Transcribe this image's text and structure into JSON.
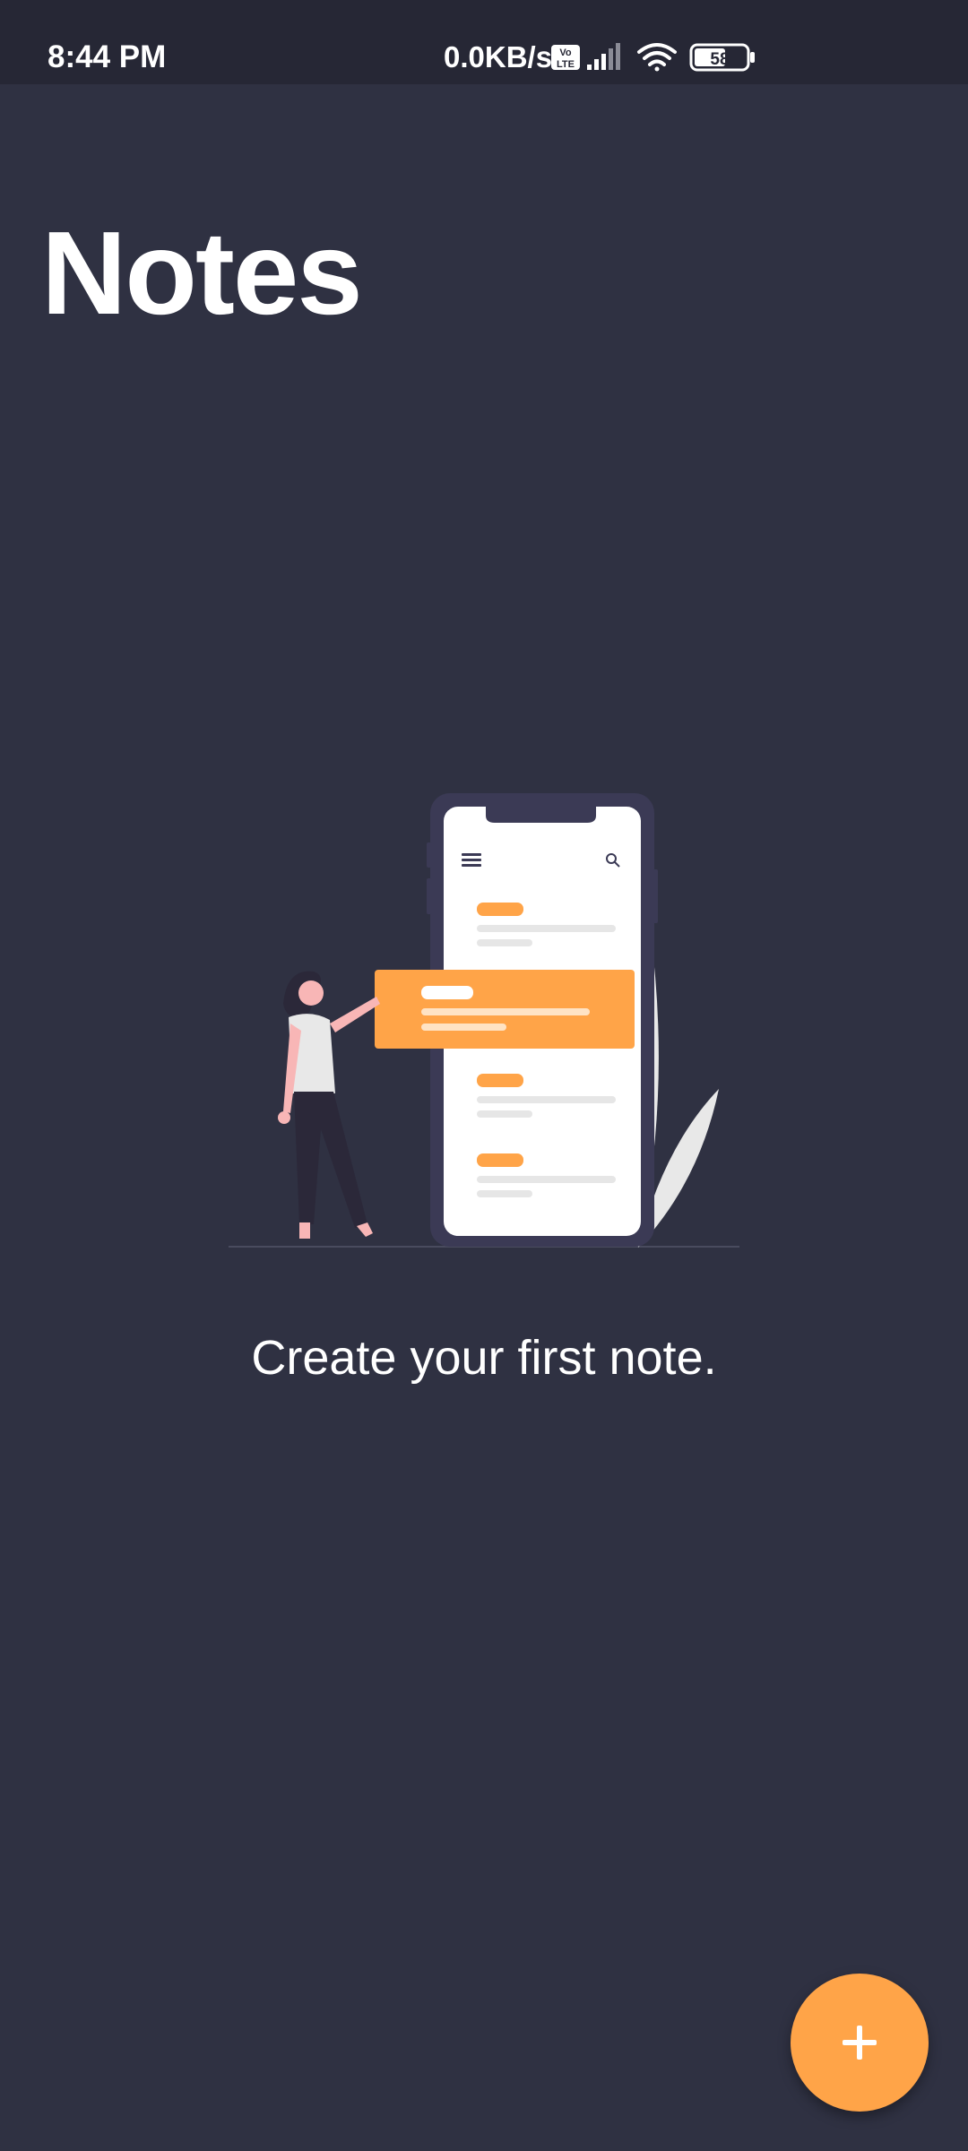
{
  "status_bar": {
    "time": "8:44 PM",
    "network_speed": "0.0KB/s",
    "volte_label": "Vo LTE",
    "battery_level": "58",
    "icons": [
      "volte-icon",
      "signal-icon",
      "wifi-icon",
      "battery-icon"
    ]
  },
  "header": {
    "title": "Notes"
  },
  "empty_state": {
    "message": "Create your first note.",
    "illustration": "person-holding-note-card-phone"
  },
  "fab": {
    "icon": "plus-icon",
    "label": "+"
  },
  "colors": {
    "background": "#2f3142",
    "status_bar": "#262735",
    "accent": "#ffa448",
    "text": "#ffffff"
  }
}
